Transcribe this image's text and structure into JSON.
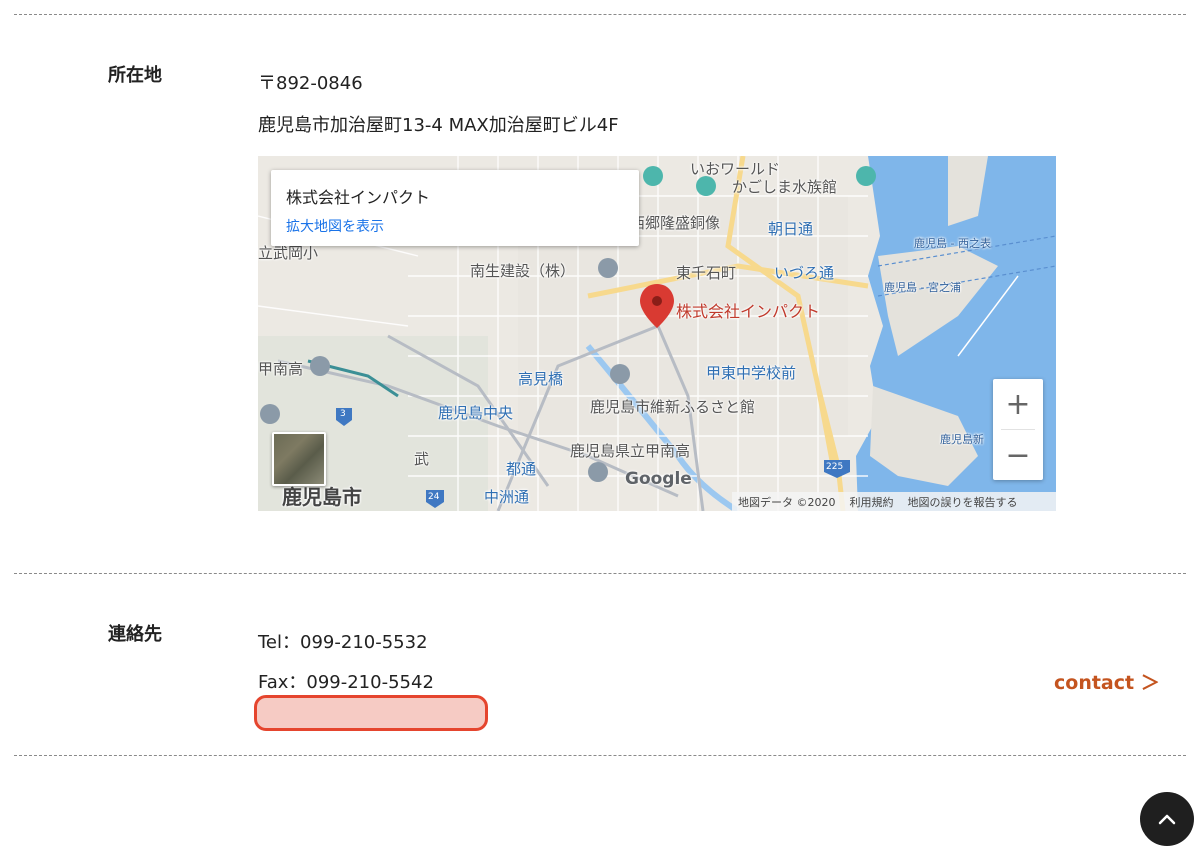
{
  "address": {
    "label": "所在地",
    "postal": "〒892-0846",
    "street": "鹿児島市加治屋町13-4 MAX加治屋町ビル4F"
  },
  "map": {
    "info_card": {
      "title": "株式会社インパクト",
      "link": "拡大地図を表示"
    },
    "marker_label": "株式会社インパクト",
    "place_labels": [
      "いおワールド",
      "かごしま水族館",
      "西郷隆盛銅像",
      "朝日通",
      "南生建設（株）",
      "東千石町",
      "いづろ通",
      "鹿児島 - 西之表",
      "鹿児島 - 宮之浦",
      "立武岡小",
      "鹿児島市",
      "高見橋",
      "甲東中学校前",
      "鹿児島中央",
      "鹿児島市維新ふるさと館",
      "鹿児島県立甲南高",
      "都通",
      "中洲通",
      "武",
      "鹿児島新",
      "甲南高"
    ],
    "road_numbers": [
      "3",
      "24",
      "225"
    ],
    "zoom_in": "+",
    "zoom_out": "−",
    "google_logo": "Google",
    "attribution": {
      "data": "地図データ ©2020",
      "terms": "利用規約",
      "report": "地図の誤りを報告する"
    },
    "colors": {
      "land": "#ece9e3",
      "water": "#7fb6ea",
      "road_major": "#f7d98d",
      "marker": "#d93a32"
    }
  },
  "contact": {
    "label": "連絡先",
    "tel": "Tel：099-210-5532",
    "fax": "Fax：099-210-5542",
    "link": "contact ＞"
  },
  "colors": {
    "accent": "#c4541f",
    "redaction_border": "#e5452e",
    "redaction_fill": "#f6cbc4"
  },
  "icons": {
    "back_to_top": "chevron-up-icon",
    "marker": "map-pin-icon"
  }
}
